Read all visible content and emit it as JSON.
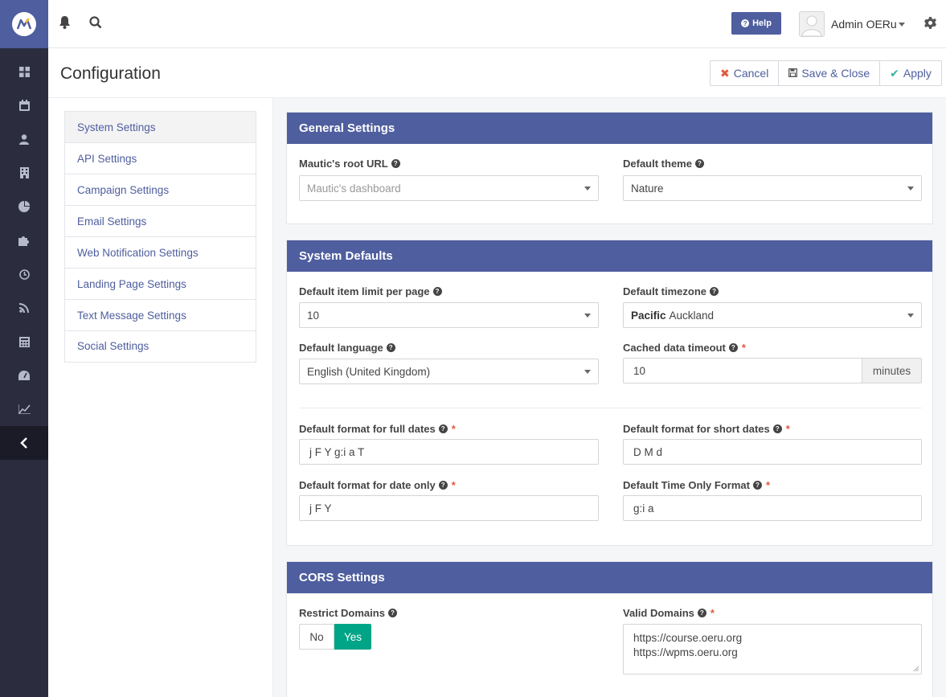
{
  "topbar": {
    "help_label": "Help",
    "user_name": "Admin OERu"
  },
  "page": {
    "title": "Configuration",
    "buttons": {
      "cancel": "Cancel",
      "save_close": "Save & Close",
      "apply": "Apply"
    }
  },
  "settings_nav": [
    {
      "label": "System Settings",
      "active": true
    },
    {
      "label": "API Settings"
    },
    {
      "label": "Campaign Settings"
    },
    {
      "label": "Email Settings"
    },
    {
      "label": "Web Notification Settings"
    },
    {
      "label": "Landing Page Settings"
    },
    {
      "label": "Text Message Settings"
    },
    {
      "label": "Social Settings"
    }
  ],
  "general": {
    "title": "General Settings",
    "root_url_label": "Mautic's root URL",
    "root_url_placeholder": "Mautic's dashboard",
    "theme_label": "Default theme",
    "theme_value": "Nature"
  },
  "defaults": {
    "title": "System Defaults",
    "item_limit_label": "Default item limit per page",
    "item_limit_value": "10",
    "timezone_label": "Default timezone",
    "timezone_region": "Pacific",
    "timezone_city": "Auckland",
    "language_label": "Default language",
    "language_value": "English (United Kingdom)",
    "cache_label": "Cached data timeout",
    "cache_value": "10",
    "cache_unit": "minutes",
    "full_date_label": "Default format for full dates",
    "full_date_value": "j F Y g:i a T",
    "short_date_label": "Default format for short dates",
    "short_date_value": "D M d",
    "date_only_label": "Default format for date only",
    "date_only_value": "j F Y",
    "time_only_label": "Default Time Only Format",
    "time_only_value": "g:i a"
  },
  "cors": {
    "title": "CORS Settings",
    "restrict_label": "Restrict Domains",
    "no_label": "No",
    "yes_label": "Yes",
    "restrict_selected": "Yes",
    "valid_label": "Valid Domains",
    "valid_lines": [
      "https://course.oeru.org",
      "https://wpms.oeru.org"
    ]
  },
  "colors": {
    "primary": "#4e5e9e",
    "sidebar": "#2b2d3e",
    "toggle_active": "#00a486",
    "required": "#e3573f"
  },
  "icons": [
    "logo-icon",
    "dashboard-icon",
    "calendar-icon",
    "contacts-icon",
    "companies-icon",
    "segments-icon",
    "components-icon",
    "channels-icon",
    "points-icon",
    "stages-icon",
    "reports-icon",
    "collapse-icon",
    "bell-icon",
    "search-icon",
    "gear-icon",
    "help-icon"
  ]
}
